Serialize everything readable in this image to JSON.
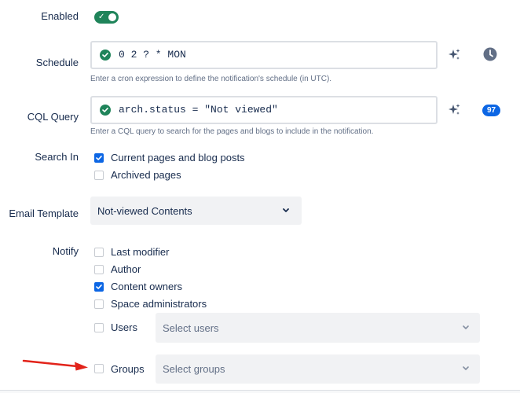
{
  "enabled": {
    "label": "Enabled",
    "checked": true
  },
  "schedule": {
    "label": "Schedule",
    "value": "0 2 ? * MON",
    "helper": "Enter a cron expression to define the notification's schedule (in UTC)."
  },
  "cql": {
    "label": "CQL Query",
    "value": "arch.status = \"Not viewed\"",
    "helper": "Enter a CQL query to search for the pages and blogs to include in the notification.",
    "badge": "97"
  },
  "search_in": {
    "label": "Search In",
    "options": [
      {
        "label": "Current pages and blog posts",
        "checked": true
      },
      {
        "label": "Archived pages",
        "checked": false
      }
    ]
  },
  "email_template": {
    "label": "Email Template",
    "selected": "Not-viewed Contents"
  },
  "notify": {
    "label": "Notify",
    "options": [
      {
        "label": "Last modifier",
        "checked": false
      },
      {
        "label": "Author",
        "checked": false
      },
      {
        "label": "Content owners",
        "checked": true
      },
      {
        "label": "Space administrators",
        "checked": false
      },
      {
        "label": "Users",
        "checked": false
      },
      {
        "label": "Groups",
        "checked": false
      }
    ],
    "users_placeholder": "Select users",
    "groups_placeholder": "Select groups"
  },
  "colors": {
    "success": "#1f845a",
    "brand": "#0c66e4",
    "arrow": "#e2231a"
  }
}
